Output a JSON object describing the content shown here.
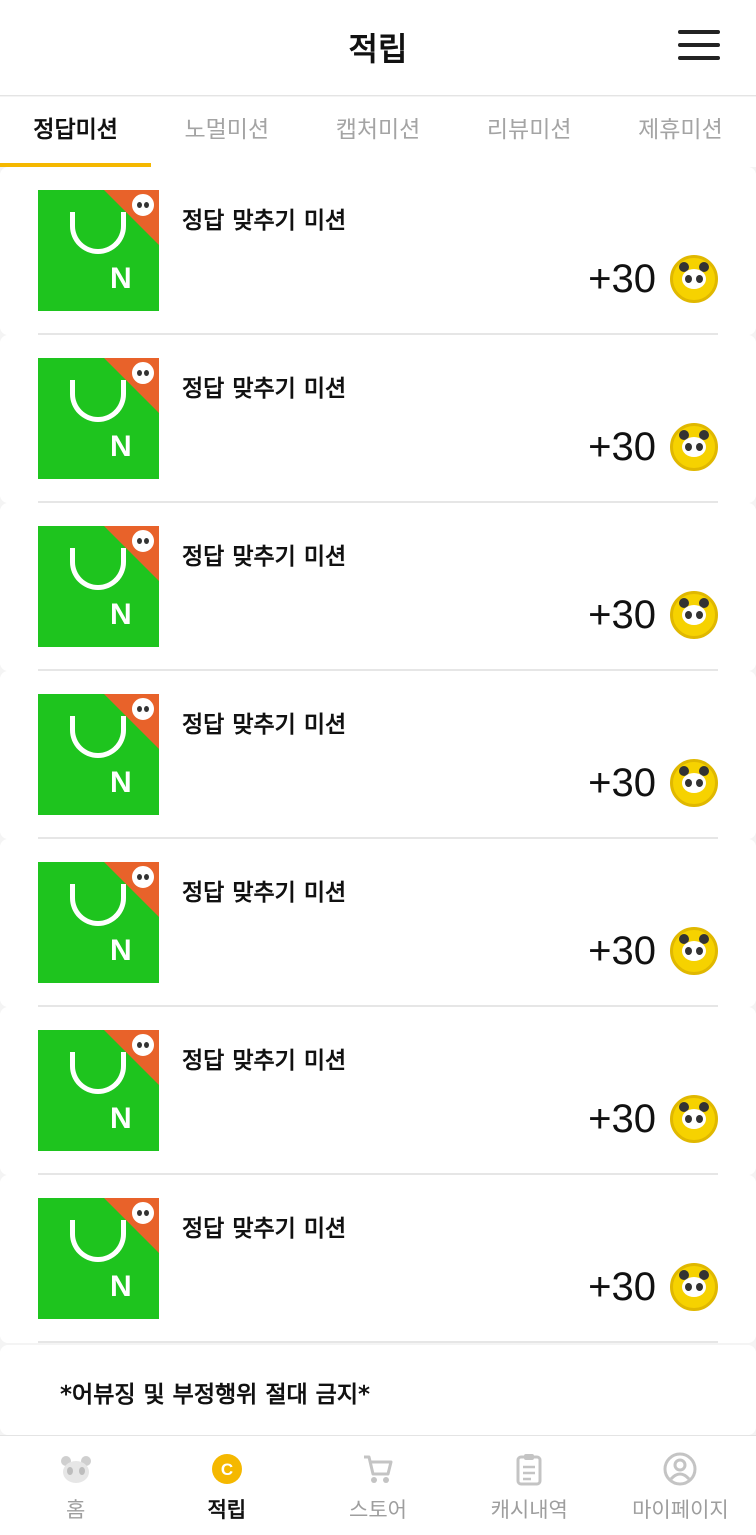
{
  "header": {
    "title": "적립",
    "menu_icon": "hamburger-icon"
  },
  "tabs": [
    {
      "label": "정답미션",
      "active": true
    },
    {
      "label": "노멀미션",
      "active": false
    },
    {
      "label": "캡처미션",
      "active": false
    },
    {
      "label": "리뷰미션",
      "active": false
    },
    {
      "label": "제휴미션",
      "active": false
    }
  ],
  "missions": [
    {
      "title": "정답 맞추기 미션",
      "reward": "+30",
      "thumb_icon": "mission-thumb-icon",
      "coin_icon": "panda-coin-icon"
    },
    {
      "title": "정답 맞추기 미션",
      "reward": "+30",
      "thumb_icon": "mission-thumb-icon",
      "coin_icon": "panda-coin-icon"
    },
    {
      "title": "정답 맞추기 미션",
      "reward": "+30",
      "thumb_icon": "mission-thumb-icon",
      "coin_icon": "panda-coin-icon"
    },
    {
      "title": "정답 맞추기 미션",
      "reward": "+30",
      "thumb_icon": "mission-thumb-icon",
      "coin_icon": "panda-coin-icon"
    },
    {
      "title": "정답 맞추기 미션",
      "reward": "+30",
      "thumb_icon": "mission-thumb-icon",
      "coin_icon": "panda-coin-icon"
    },
    {
      "title": "정답 맞추기 미션",
      "reward": "+30",
      "thumb_icon": "mission-thumb-icon",
      "coin_icon": "panda-coin-icon"
    },
    {
      "title": "정답 맞추기 미션",
      "reward": "+30",
      "thumb_icon": "mission-thumb-icon",
      "coin_icon": "panda-coin-icon"
    }
  ],
  "notice": {
    "text": "*어뷰징 및 부정행위 절대 금지*"
  },
  "bottom_nav": [
    {
      "label": "홈",
      "icon": "panda-home-icon",
      "active": false
    },
    {
      "label": "적립",
      "icon": "coin-c-icon",
      "active": true
    },
    {
      "label": "스토어",
      "icon": "cart-icon",
      "active": false
    },
    {
      "label": "캐시내역",
      "icon": "clipboard-icon",
      "active": false
    },
    {
      "label": "마이페이지",
      "icon": "user-circle-icon",
      "active": false
    }
  ],
  "colors": {
    "accent": "#f5b800",
    "thumb_green": "#1ec41e",
    "thumb_orange": "#e8622a",
    "coin_yellow": "#f6d200"
  }
}
